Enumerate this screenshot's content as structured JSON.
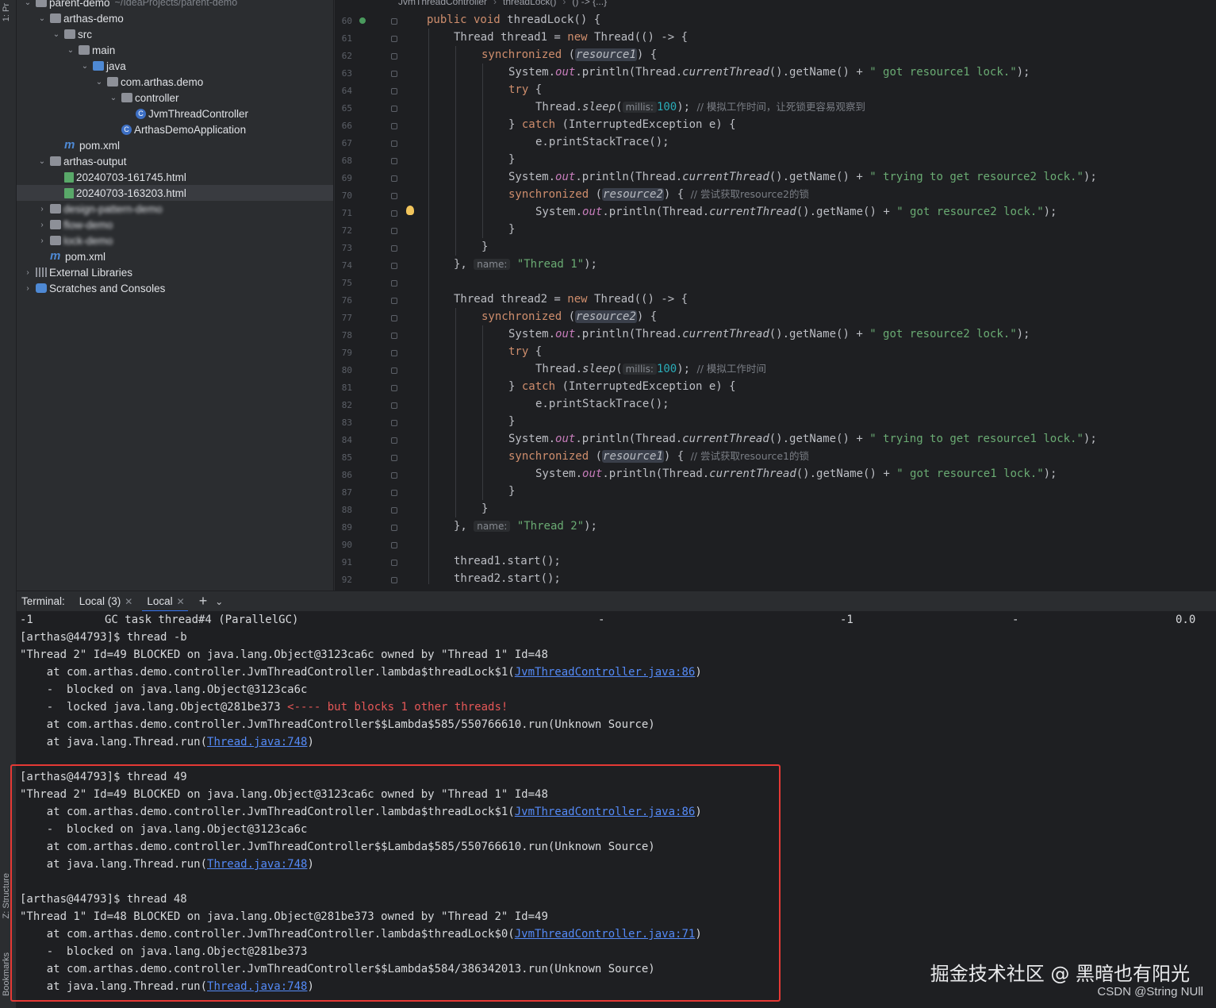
{
  "left_strip": {
    "project_tab": "1: Pr",
    "structure_tab": "Z: Structure",
    "bookmarks_tab": "Bookmarks"
  },
  "tree": [
    {
      "arrow": "⌄",
      "icon": "folder",
      "label": "parent-demo",
      "path": "~/IdeaProjects/parent-demo",
      "indent": 0
    },
    {
      "arrow": "⌄",
      "icon": "folder",
      "label": "arthas-demo",
      "path": "",
      "indent": 1
    },
    {
      "arrow": "⌄",
      "icon": "folder",
      "label": "src",
      "path": "",
      "indent": 2
    },
    {
      "arrow": "⌄",
      "icon": "folder",
      "label": "main",
      "path": "",
      "indent": 3
    },
    {
      "arrow": "⌄",
      "icon": "jfolder",
      "label": "java",
      "path": "",
      "indent": 4
    },
    {
      "arrow": "⌄",
      "icon": "pkg",
      "label": "com.arthas.demo",
      "path": "",
      "indent": 5
    },
    {
      "arrow": "⌄",
      "icon": "pkg",
      "label": "controller",
      "path": "",
      "indent": 6
    },
    {
      "arrow": "",
      "icon": "cls",
      "label": "JvmThreadController",
      "path": "",
      "indent": 7
    },
    {
      "arrow": "",
      "icon": "cls",
      "label": "ArthasDemoApplication",
      "path": "",
      "indent": 6
    },
    {
      "arrow": "",
      "icon": "maven",
      "label": "pom.xml",
      "path": "",
      "indent": 2
    },
    {
      "arrow": "⌄",
      "icon": "folder",
      "label": "arthas-output",
      "path": "",
      "indent": 1
    },
    {
      "arrow": "",
      "icon": "html",
      "label": "20240703-161745.html",
      "path": "",
      "indent": 2
    },
    {
      "arrow": "",
      "icon": "html",
      "label": "20240703-163203.html",
      "path": "",
      "indent": 2,
      "selected": true
    },
    {
      "arrow": "›",
      "icon": "folder",
      "label": "design-pattern-demo",
      "path": "",
      "indent": 1,
      "blurred": true
    },
    {
      "arrow": "›",
      "icon": "folder",
      "label": "flow-demo",
      "path": "",
      "indent": 1,
      "blurred": true
    },
    {
      "arrow": "›",
      "icon": "folder",
      "label": "lock-demo",
      "path": "",
      "indent": 1,
      "blurred": true
    },
    {
      "arrow": "",
      "icon": "maven",
      "label": "pom.xml",
      "path": "",
      "indent": 1
    },
    {
      "arrow": "›",
      "icon": "libs",
      "label": "External Libraries",
      "path": "",
      "indent": 0
    },
    {
      "arrow": "›",
      "icon": "scratch",
      "label": "Scratches and Consoles",
      "path": "",
      "indent": 0
    }
  ],
  "editor": {
    "breadcrumbs": [
      "JvmThreadController",
      "threadLock()",
      "() -> {...}"
    ],
    "line_numbers": [
      "60",
      "61",
      "62",
      "63",
      "64",
      "65",
      "66",
      "67",
      "68",
      "69",
      "70",
      "71",
      "72",
      "73",
      "74",
      "75",
      "76",
      "77",
      "78",
      "79",
      "80",
      "81",
      "82",
      "83",
      "84",
      "85",
      "86",
      "87",
      "88",
      "89",
      "90",
      "91",
      "92"
    ],
    "code": {
      "l60_kw": "public void",
      "l60_rest": " threadLock() {",
      "l61_a": "Thread thread1 = ",
      "l61_kw": "new",
      "l61_b": " Thread(() -> {",
      "l62_kw": "synchronized",
      "l62_a": " (",
      "l62_res": "resource1",
      "l62_b": ") {",
      "l63_a": "System.",
      "l63_out": "out",
      "l63_b": ".println(Thread.",
      "l63_it": "currentThread",
      "l63_c": "().getName() + ",
      "l63_str": "\" got resource1 lock.\"",
      "l63_d": ");",
      "l64_kw": "try",
      "l64_b": " {",
      "l65_a": "Thread.",
      "l65_it": "sleep",
      "l65_b": "(",
      "l65_hint": "millis:",
      "l65_num": "100",
      "l65_c": "); ",
      "l65_cmt": "// 模拟工作时间，让死锁更容易观察到",
      "l66_a": "} ",
      "l66_kw": "catch",
      "l66_b": " (InterruptedException e) {",
      "l67_a": "e.printStackTrace();",
      "l68_a": "}",
      "l69_a": "System.",
      "l69_out": "out",
      "l69_b": ".println(Thread.",
      "l69_it": "currentThread",
      "l69_c": "().getName() + ",
      "l69_str": "\" trying to get resource2 lock.\"",
      "l69_d": ");",
      "l70_kw": "synchronized",
      "l70_a": " (",
      "l70_res": "resource2",
      "l70_b": ") { ",
      "l70_cmt": "// 尝试获取resource2的锁",
      "l71_a": "System.",
      "l71_out": "out",
      "l71_b": ".println(Thread.",
      "l71_it": "currentThread",
      "l71_c": "().getName() + ",
      "l71_str": "\" got resource2 lock.\"",
      "l71_d": ");",
      "l72_a": "}",
      "l73_a": "}",
      "l74_a": "}, ",
      "l74_hint": "name:",
      "l74_str": "\"Thread 1\"",
      "l74_b": ");",
      "l76_a": "Thread thread2 = ",
      "l76_kw": "new",
      "l76_b": " Thread(() -> {",
      "l77_kw": "synchronized",
      "l77_a": " (",
      "l77_res": "resource2",
      "l77_b": ") {",
      "l78_a": "System.",
      "l78_out": "out",
      "l78_b": ".println(Thread.",
      "l78_it": "currentThread",
      "l78_c": "().getName() + ",
      "l78_str": "\" got resource2 lock.\"",
      "l78_d": ");",
      "l79_kw": "try",
      "l79_b": " {",
      "l80_a": "Thread.",
      "l80_it": "sleep",
      "l80_b": "(",
      "l80_hint": "millis:",
      "l80_num": "100",
      "l80_c": "); ",
      "l80_cmt": "// 模拟工作时间",
      "l81_a": "} ",
      "l81_kw": "catch",
      "l81_b": " (InterruptedException e) {",
      "l82_a": "e.printStackTrace();",
      "l83_a": "}",
      "l84_a": "System.",
      "l84_out": "out",
      "l84_b": ".println(Thread.",
      "l84_it": "currentThread",
      "l84_c": "().getName() + ",
      "l84_str": "\" trying to get resource1 lock.\"",
      "l84_d": ");",
      "l85_kw": "synchronized",
      "l85_a": " (",
      "l85_res": "resource1",
      "l85_b": ") { ",
      "l85_cmt": "// 尝试获取resource1的锁",
      "l86_a": "System.",
      "l86_out": "out",
      "l86_b": ".println(Thread.",
      "l86_it": "currentThread",
      "l86_c": "().getName() + ",
      "l86_str": "\" got resource1 lock.\"",
      "l86_d": ");",
      "l87_a": "}",
      "l88_a": "}",
      "l89_a": "}, ",
      "l89_hint": "name:",
      "l89_str": "\"Thread 2\"",
      "l89_b": ");",
      "l91_a": "thread1.start();",
      "l92_a": "thread2.start();"
    }
  },
  "terminal": {
    "label": "Terminal:",
    "tabs": [
      {
        "label": "Local (3)"
      },
      {
        "label": "Local"
      }
    ],
    "gc_row": {
      "id": "-1",
      "name": "GC task thread#4 (ParallelGC)",
      "c1": "-",
      "c2": "-1",
      "c3": "-",
      "c4": "0.0"
    },
    "lines": {
      "t1": "[arthas@44793]$ thread -b",
      "t2": "\"Thread 2\" Id=49 BLOCKED on java.lang.Object@3123ca6c owned by \"Thread 1\" Id=48",
      "t3a": "    at com.arthas.demo.controller.JvmThreadController.lambda$threadLock$1(",
      "t3l": "JvmThreadController.java:86",
      "t3b": ")",
      "t4": "    -  blocked on java.lang.Object@3123ca6c",
      "t5a": "    -  locked java.lang.Object@281be373 ",
      "t5r": "<---- but blocks 1 other threads!",
      "t6": "    at com.arthas.demo.controller.JvmThreadController$$Lambda$585/550766610.run(Unknown Source)",
      "t7a": "    at java.lang.Thread.run(",
      "t7l": "Thread.java:748",
      "t7b": ")",
      "t9": "[arthas@44793]$ thread 49",
      "t10": "\"Thread 2\" Id=49 BLOCKED on java.lang.Object@3123ca6c owned by \"Thread 1\" Id=48",
      "t11a": "    at com.arthas.demo.controller.JvmThreadController.lambda$threadLock$1(",
      "t11l": "JvmThreadController.java:86",
      "t11b": ")",
      "t12": "    -  blocked on java.lang.Object@3123ca6c",
      "t13": "    at com.arthas.demo.controller.JvmThreadController$$Lambda$585/550766610.run(Unknown Source)",
      "t14a": "    at java.lang.Thread.run(",
      "t14l": "Thread.java:748",
      "t14b": ")",
      "t16": "[arthas@44793]$ thread 48",
      "t17": "\"Thread 1\" Id=48 BLOCKED on java.lang.Object@281be373 owned by \"Thread 2\" Id=49",
      "t18a": "    at com.arthas.demo.controller.JvmThreadController.lambda$threadLock$0(",
      "t18l": "JvmThreadController.java:71",
      "t18b": ")",
      "t19": "    -  blocked on java.lang.Object@281be373",
      "t20": "    at com.arthas.demo.controller.JvmThreadController$$Lambda$584/386342013.run(Unknown Source)",
      "t21a": "    at java.lang.Thread.run(",
      "t21l": "Thread.java:748",
      "t21b": ")"
    }
  },
  "watermark": {
    "line1": "掘金技术社区 @ 黑暗也有阳光",
    "line2": "CSDN @String NUll"
  },
  "colors": {
    "highlight_box": "#e53935",
    "link": "#548af7",
    "keyword": "#cf8e6d",
    "string": "#6aab73"
  }
}
